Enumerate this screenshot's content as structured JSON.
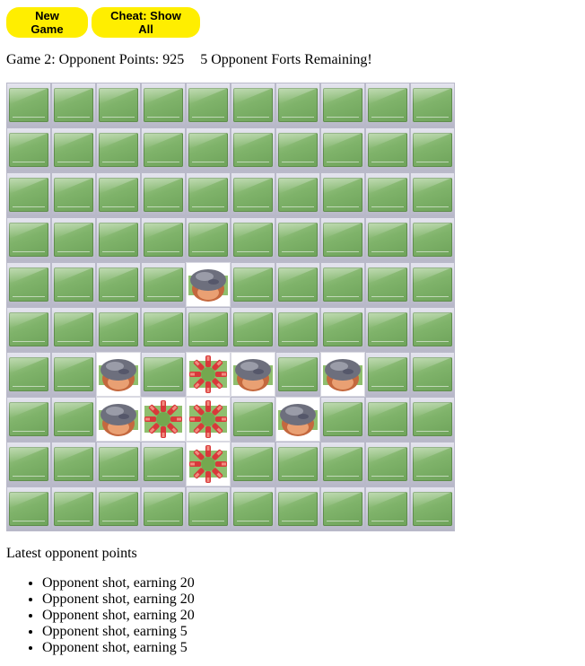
{
  "toolbar": {
    "new_game_label": "New Game",
    "cheat_label": "Cheat: Show All",
    "button_color": "#ffee00"
  },
  "status": {
    "game_text": "Game 2: Opponent Points: 925",
    "forts_text": "5 Opponent Forts Remaining!"
  },
  "board": {
    "rows": 10,
    "cols": 10,
    "cell_icons": {
      "hidden": "grass-tile-icon",
      "fort": "boulder-fort-icon",
      "hit": "explosion-hit-icon"
    },
    "revealed": [
      {
        "row": 5,
        "col": 5,
        "kind": "fort"
      },
      {
        "row": 7,
        "col": 3,
        "kind": "fort"
      },
      {
        "row": 7,
        "col": 5,
        "kind": "hit"
      },
      {
        "row": 7,
        "col": 6,
        "kind": "fort"
      },
      {
        "row": 7,
        "col": 8,
        "kind": "fort"
      },
      {
        "row": 8,
        "col": 3,
        "kind": "fort"
      },
      {
        "row": 8,
        "col": 4,
        "kind": "hit"
      },
      {
        "row": 8,
        "col": 5,
        "kind": "hit"
      },
      {
        "row": 8,
        "col": 7,
        "kind": "fort"
      },
      {
        "row": 9,
        "col": 5,
        "kind": "hit"
      }
    ]
  },
  "latest": {
    "title": "Latest opponent points",
    "items": [
      "Opponent shot, earning 20",
      "Opponent shot, earning 20",
      "Opponent shot, earning 20",
      "Opponent shot, earning 5",
      "Opponent shot, earning 5"
    ]
  }
}
